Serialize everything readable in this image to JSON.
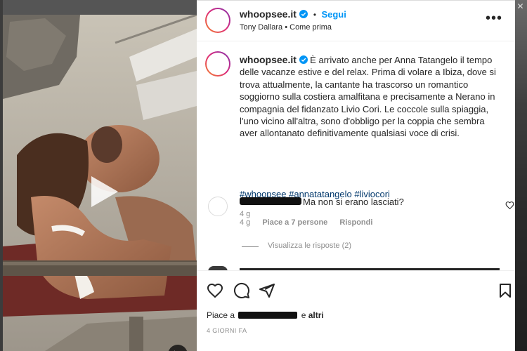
{
  "post": {
    "username": "whoopsee.it",
    "follow_label": "Segui",
    "audio_artist": "Tony Dallara",
    "audio_separator": "•",
    "audio_title": "Come prima"
  },
  "caption": {
    "username": "whoopsee.it",
    "text": "È arrivato anche per Anna Tatangelo il tempo delle vacanze estive e del relax. Prima di volare a Ibiza, dove si trova attualmente, la cantante ha trascorso un romantico soggiorno sulla costiera amalfitana e precisamente a Nerano in compagnia del fidanzato Livio Cori. Le coccole sulla spiaggia, l'uno vicino all'altra, sono d'obbligo per la coppia che sembra aver allontanato definitivamente qualsiasi voce di crisi.",
    "hashtags": "#whoopsee #annatatangelo #liviocori",
    "age": "4 g"
  },
  "comment": {
    "text": "Ma non si erano lasciati?",
    "age": "4 g",
    "likes_label": "Piace a 7 persone",
    "reply_label": "Rispondi",
    "view_replies_label": "Visualizza le risposte (2)"
  },
  "likes": {
    "prefix": "Piace a",
    "connector": "e",
    "others": "altri"
  },
  "timestamp": "4 GIORNI FA",
  "icons": {
    "more": "more-options-icon",
    "verified": "verified-badge-icon",
    "play": "play-icon",
    "mute": "muted-speaker-icon",
    "like": "heart-icon",
    "comment": "comment-bubble-icon",
    "share": "paper-plane-icon",
    "save": "bookmark-icon"
  },
  "colors": {
    "accent": "#0095f6",
    "hashtag": "#00376b",
    "verified": "#0095f6"
  }
}
